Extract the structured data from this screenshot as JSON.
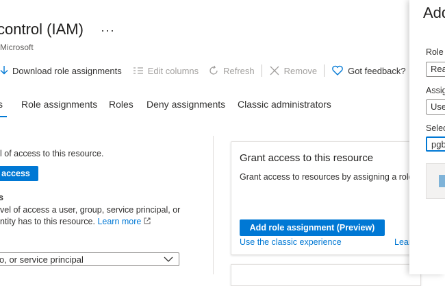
{
  "page": {
    "title": "control (IAM)",
    "more": "···",
    "subtitle": "Microsoft"
  },
  "toolbar": {
    "download": "Download role assignments",
    "edit_columns": "Edit columns",
    "refresh": "Refresh",
    "remove": "Remove",
    "feedback": "Got feedback?"
  },
  "tabs": {
    "access_partial": "ss",
    "role_assignments": "Role assignments",
    "roles": "Roles",
    "deny_assignments": "Deny assignments",
    "classic_admins": "Classic administrators"
  },
  "left": {
    "intro": "l of access to this resource.",
    "add_button": "access",
    "check_heading": "s",
    "check_line1": "vel of access a user, group, service principal, or",
    "check_line2": "ntity has to this resource.",
    "learn_more": "Learn more",
    "dropdown_value": "o, or service principal"
  },
  "card": {
    "title": "Grant access to this resource",
    "description": "Grant access to resources by assigning a role.",
    "button": "Add role assignment (Preview)",
    "classic_link": "Use the classic experience",
    "learn_partial": "Lear"
  },
  "panel": {
    "title": "Add",
    "role_label": "Role",
    "role_value": "Rea",
    "assign_label": "Assig",
    "assign_value": "Use",
    "select_label": "Selec",
    "select_value": "pgb"
  },
  "colors": {
    "accent": "#0078d4",
    "text": "#323130",
    "disabled": "#a19f9d"
  }
}
